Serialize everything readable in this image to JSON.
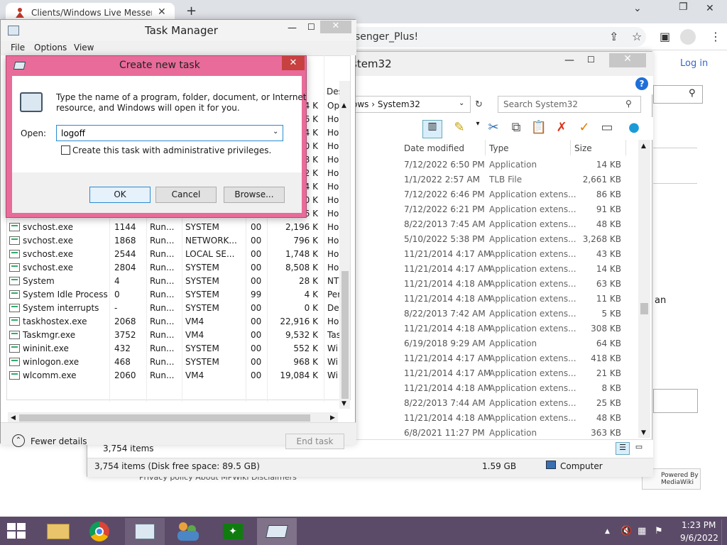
{
  "chrome": {
    "tab_title": "Clients/Windows Live Messenger",
    "tab_close": "✕",
    "new_tab": "+",
    "omnibox_text": "senger_Plus!",
    "login": "Log in"
  },
  "wiki": {
    "partial_text": "an",
    "mediawiki": "Powered By MediaWiki",
    "footer": "Privacy policy   About MPWiki   Disclaimers"
  },
  "explorer": {
    "title": "stem32",
    "address": "ows  ›  System32",
    "search_placeholder": "Search System32",
    "help": "?",
    "columns": {
      "date": "Date modified",
      "type": "Type",
      "size": "Size"
    },
    "files": [
      {
        "date": "7/12/2022 6:50 PM",
        "type": "Application",
        "size": "14 KB"
      },
      {
        "date": "1/1/2022 2:57 AM",
        "type": "TLB File",
        "size": "2,661 KB"
      },
      {
        "date": "7/12/2022 6:46 PM",
        "type": "Application extens...",
        "size": "86 KB"
      },
      {
        "date": "7/12/2022 6:21 PM",
        "type": "Application extens...",
        "size": "91 KB"
      },
      {
        "date": "8/22/2013 7:45 AM",
        "type": "Application extens...",
        "size": "48 KB"
      },
      {
        "date": "5/10/2022 5:38 PM",
        "type": "Application extens...",
        "size": "3,268 KB"
      },
      {
        "date": "11/21/2014 4:17 AM",
        "type": "Application extens...",
        "size": "43 KB"
      },
      {
        "date": "11/21/2014 4:17 AM",
        "type": "Application extens...",
        "size": "14 KB"
      },
      {
        "date": "11/21/2014 4:18 AM",
        "type": "Application extens...",
        "size": "63 KB"
      },
      {
        "date": "11/21/2014 4:18 AM",
        "type": "Application extens...",
        "size": "11 KB"
      },
      {
        "date": "8/22/2013 7:42 AM",
        "type": "Application extens...",
        "size": "5 KB"
      },
      {
        "date": "11/21/2014 4:18 AM",
        "type": "Application extens...",
        "size": "308 KB"
      },
      {
        "date": "6/19/2018 9:29 AM",
        "type": "Application",
        "size": "64 KB"
      },
      {
        "date": "11/21/2014 4:17 AM",
        "type": "Application extens...",
        "size": "418 KB"
      },
      {
        "date": "11/21/2014 4:17 AM",
        "type": "Application extens...",
        "size": "21 KB"
      },
      {
        "date": "11/21/2014 4:18 AM",
        "type": "Application extens...",
        "size": "8 KB"
      },
      {
        "date": "8/22/2013 7:44 AM",
        "type": "Application extens...",
        "size": "25 KB"
      },
      {
        "date": "11/21/2014 4:18 AM",
        "type": "Application extens...",
        "size": "48 KB"
      },
      {
        "date": "6/8/2021 11:27 PM",
        "type": "Application",
        "size": "363 KB"
      }
    ],
    "count": "3,754 items",
    "status_items": "3,754 items (Disk free space: 89.5 GB)",
    "status_size": "1.59 GB",
    "status_computer": "Computer"
  },
  "taskmgr": {
    "title": "Task Manager",
    "menu": [
      "File",
      "Options",
      "View"
    ],
    "desc_header": "Des",
    "partial_rows": [
      {
        "mem": "4 K",
        "desc": "Op"
      },
      {
        "mem": "6 K",
        "desc": "Ho"
      },
      {
        "mem": "4 K",
        "desc": "Ho"
      },
      {
        "mem": "0 K",
        "desc": "Ho"
      },
      {
        "mem": "8 K",
        "desc": "Ho"
      },
      {
        "mem": "2 K",
        "desc": "Ho"
      },
      {
        "mem": "4 K",
        "desc": "Ho"
      },
      {
        "mem": "0 K",
        "desc": "Ho"
      },
      {
        "mem": "6 K",
        "desc": "Ho"
      }
    ],
    "processes": [
      {
        "name": "svchost.exe",
        "pid": "1144",
        "status": "Run...",
        "user": "SYSTEM",
        "cpu": "00",
        "mem": "2,196 K",
        "desc": "Ho"
      },
      {
        "name": "svchost.exe",
        "pid": "1868",
        "status": "Run...",
        "user": "NETWORK...",
        "cpu": "00",
        "mem": "796 K",
        "desc": "Ho"
      },
      {
        "name": "svchost.exe",
        "pid": "2544",
        "status": "Run...",
        "user": "LOCAL SE...",
        "cpu": "00",
        "mem": "1,748 K",
        "desc": "Ho"
      },
      {
        "name": "svchost.exe",
        "pid": "2804",
        "status": "Run...",
        "user": "SYSTEM",
        "cpu": "00",
        "mem": "8,508 K",
        "desc": "Ho"
      },
      {
        "name": "System",
        "pid": "4",
        "status": "Run...",
        "user": "SYSTEM",
        "cpu": "00",
        "mem": "28 K",
        "desc": "NT"
      },
      {
        "name": "System Idle Process",
        "pid": "0",
        "status": "Run...",
        "user": "SYSTEM",
        "cpu": "99",
        "mem": "4 K",
        "desc": "Per"
      },
      {
        "name": "System interrupts",
        "pid": "-",
        "status": "Run...",
        "user": "SYSTEM",
        "cpu": "00",
        "mem": "0 K",
        "desc": "Det"
      },
      {
        "name": "taskhostex.exe",
        "pid": "2068",
        "status": "Run...",
        "user": "VM4",
        "cpu": "00",
        "mem": "22,916 K",
        "desc": "Ho"
      },
      {
        "name": "Taskmgr.exe",
        "pid": "3752",
        "status": "Run...",
        "user": "VM4",
        "cpu": "00",
        "mem": "9,532 K",
        "desc": "Tas"
      },
      {
        "name": "wininit.exe",
        "pid": "432",
        "status": "Run...",
        "user": "SYSTEM",
        "cpu": "00",
        "mem": "552 K",
        "desc": "Wi"
      },
      {
        "name": "winlogon.exe",
        "pid": "468",
        "status": "Run...",
        "user": "SYSTEM",
        "cpu": "00",
        "mem": "968 K",
        "desc": "Wi"
      },
      {
        "name": "wlcomm.exe",
        "pid": "2060",
        "status": "Run...",
        "user": "VM4",
        "cpu": "00",
        "mem": "19,084 K",
        "desc": "Wi"
      }
    ],
    "fewer_details": "Fewer details",
    "end_task": "End task"
  },
  "dialog": {
    "title": "Create new task",
    "close": "✕",
    "desc_line1": "Type the name of a program, folder, document, or Internet",
    "desc_line2": "resource, and Windows will open it for you.",
    "open_label": "Open:",
    "open_value": "logoff",
    "admin_label": "Create this task with administrative privileges.",
    "ok": "OK",
    "cancel": "Cancel",
    "browse": "Browse..."
  },
  "taskbar": {
    "time": "1:23 PM",
    "date": "9/6/2022"
  },
  "colors": {
    "dialog_frame": "#e86b99",
    "taskbar": "#5b4b68",
    "accent": "#2a8bd1"
  }
}
